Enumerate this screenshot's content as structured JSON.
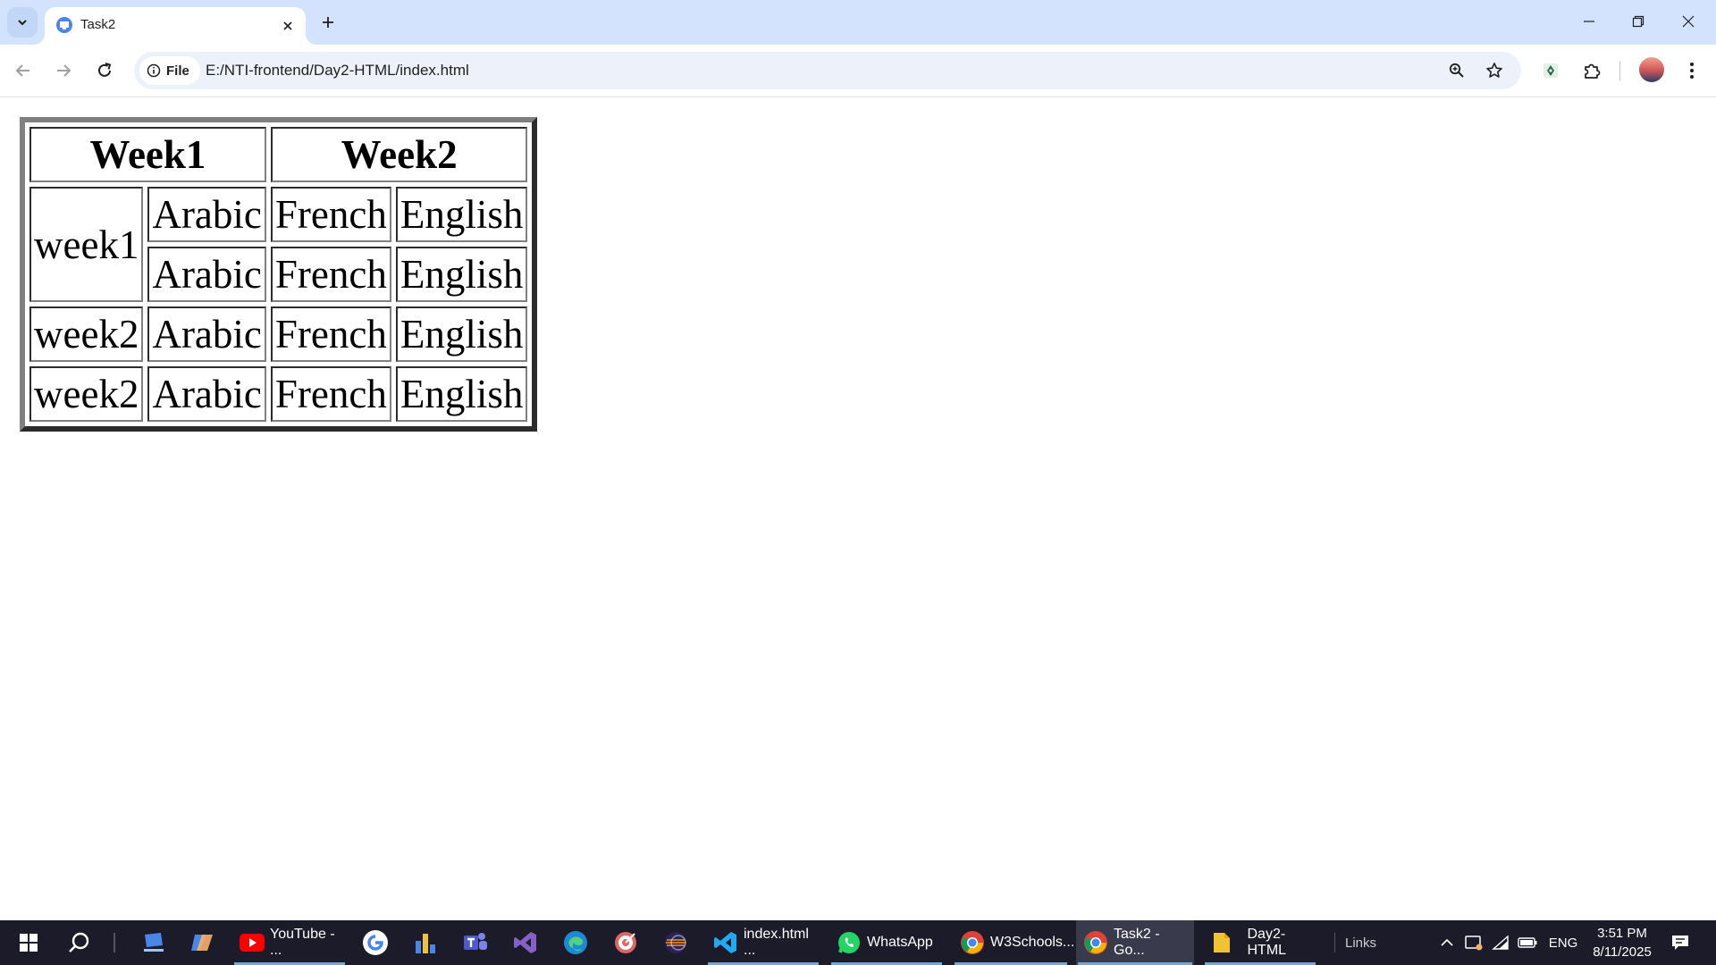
{
  "browser": {
    "tab": {
      "title": "Task2"
    },
    "address": {
      "chip_label": "File",
      "url": "E:/NTI-frontend/Day2-HTML/index.html"
    }
  },
  "page": {
    "table": {
      "headers": [
        "Week1",
        "Week2"
      ],
      "row1": {
        "label": "week1",
        "cells": [
          "Arabic",
          "French",
          "English"
        ]
      },
      "row2": {
        "cells": [
          "Arabic",
          "French",
          "English"
        ]
      },
      "row3": {
        "label": "week2",
        "cells": [
          "Arabic",
          "French",
          "English"
        ]
      },
      "row4": {
        "label": "week2",
        "cells": [
          "Arabic",
          "French",
          "English"
        ]
      }
    }
  },
  "taskbar": {
    "items": [
      {
        "label": "YouTube - ...",
        "icon": "youtube-icon"
      },
      {
        "label": "index.html ...",
        "icon": "vscode-icon"
      },
      {
        "label": "WhatsApp",
        "icon": "whatsapp-icon"
      },
      {
        "label": "W3Schools...",
        "icon": "chrome-icon"
      },
      {
        "label": "Task2 - Go...",
        "icon": "chrome-icon"
      },
      {
        "label": "Day2-HTML",
        "icon": "folder-icon"
      }
    ],
    "links_label": "Links",
    "language": "ENG",
    "time": "3:51 PM",
    "date": "8/11/2025"
  },
  "colors": {
    "tabstrip": "#d3e3fd",
    "omnibox": "#edf2fa",
    "taskbar": "#1b1b2a"
  }
}
